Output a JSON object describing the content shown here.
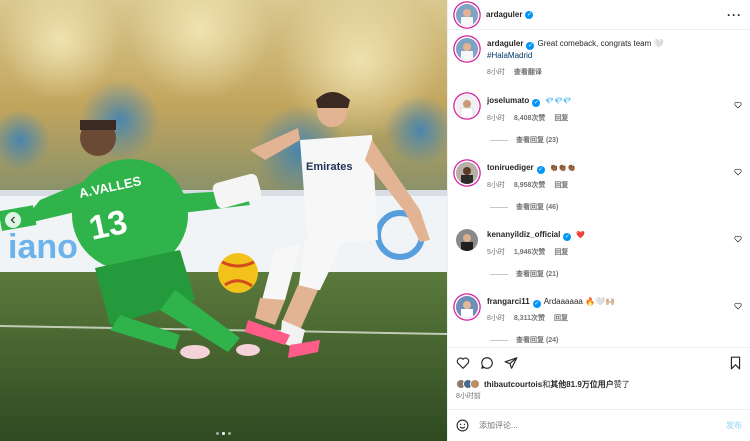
{
  "post": {
    "author": "ardaguler",
    "header_more": "···"
  },
  "caption": {
    "username": "ardaguler",
    "text": "Great comeback, congrats team 🤍",
    "hashtag": "#HalaMadrid",
    "time": "8小时",
    "see_translation": "查看翻译"
  },
  "comments": [
    {
      "username": "joselumato",
      "text": "💎💎💎",
      "time": "8小时",
      "likes": "8,408次赞",
      "reply": "回复",
      "view_replies": "查看回复 (23)"
    },
    {
      "username": "toniruediger",
      "text": "👏🏾👏🏾👏🏾",
      "time": "8小时",
      "likes": "8,958次赞",
      "reply": "回复",
      "view_replies": "查看回复 (46)"
    },
    {
      "username": "kenanyildiz_official",
      "text": "❤️",
      "time": "5小时",
      "likes": "1,946次赞",
      "reply": "回复",
      "view_replies": "查看回复 (21)"
    },
    {
      "username": "frangarci11",
      "text": "Ardaaaaaa 🔥🤍🙌🏼",
      "time": "8小时",
      "likes": "8,311次赞",
      "reply": "回复",
      "view_replies": "查看回复 (24)"
    }
  ],
  "likes": {
    "prefix": "thibautcourtois",
    "middle": "和",
    "others": "其他81.9万位用户",
    "suffix": "赞了"
  },
  "post_time": "8小时前",
  "composer": {
    "placeholder": "添加评论...",
    "post_label": "发布"
  },
  "photo": {
    "jersey_name": "A.VALLES",
    "jersey_number": "13",
    "sponsor": "Emirates",
    "active_slide": 2,
    "slide_count": 3
  },
  "colors": {
    "verified": "#0095f6",
    "story_ring": "#d6249f",
    "keeper_kit": "#2fb34a",
    "pitch": "#3c5a2c"
  }
}
